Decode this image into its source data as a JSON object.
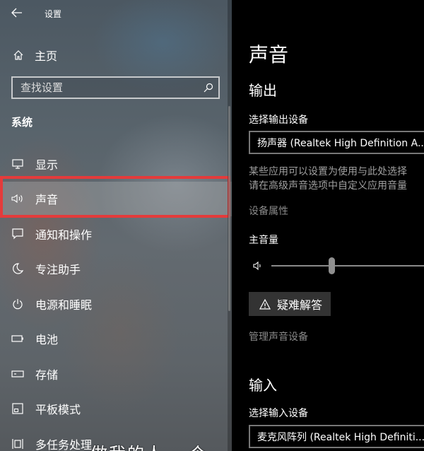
{
  "window": {
    "title": "设置"
  },
  "sidebar": {
    "home_label": "主页",
    "search_placeholder": "查找设置",
    "section_title": "系统",
    "items": [
      {
        "label": "显示",
        "icon": "monitor-icon"
      },
      {
        "label": "声音",
        "icon": "speaker-icon",
        "active": true
      },
      {
        "label": "通知和操作",
        "icon": "notification-icon"
      },
      {
        "label": "专注助手",
        "icon": "moon-icon"
      },
      {
        "label": "电源和睡眠",
        "icon": "power-icon"
      },
      {
        "label": "电池",
        "icon": "battery-icon"
      },
      {
        "label": "存储",
        "icon": "storage-icon"
      },
      {
        "label": "平板模式",
        "icon": "tablet-mode-icon"
      },
      {
        "label": "多任务处理",
        "icon": "multitasking-icon"
      }
    ],
    "overlay_text": "做我的人 一个"
  },
  "main": {
    "title": "声音",
    "output": {
      "heading": "输出",
      "device_label": "选择输出设备",
      "device_value": "扬声器 (Realtek High Definition A...",
      "description_line1": "某些应用可以设置为使用与此处选择",
      "description_line2": "请在高级声音选项中自定义应用音量",
      "device_properties_link": "设备属性",
      "master_volume_label": "主音量",
      "master_volume_level": 0.37,
      "troubleshoot_label": "疑难解答",
      "manage_devices_link": "管理声音设备"
    },
    "input": {
      "heading": "输入",
      "device_label": "选择输入设备",
      "device_value": "麦克风阵列 (Realtek High Definiti..."
    }
  },
  "colors": {
    "highlight": "#e43b3b",
    "main_background": "#000000"
  }
}
